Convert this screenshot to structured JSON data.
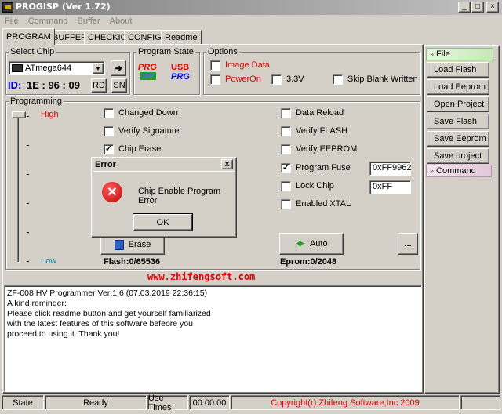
{
  "window": {
    "title": "PROGISP (Ver 1.72)"
  },
  "menu": [
    "File",
    "Command",
    "Buffer",
    "About"
  ],
  "tabs": [
    "PROGRAM",
    "BUFFER",
    "CHECKIO",
    "CONFIG",
    "Readme"
  ],
  "select_chip": {
    "group_label": "Select Chip",
    "chip": "ATmega644",
    "id_label": "ID:",
    "id_value": "1E : 96 : 09",
    "rd_label": "RD",
    "sn_label": "SN"
  },
  "program_state": {
    "group_label": "Program State",
    "logo1_top": "PRG",
    "logo1_bottom": "ISP",
    "logo2_top": "USB",
    "logo2_bottom": "PRG"
  },
  "options": {
    "group_label": "Options",
    "image_data": "Image Data",
    "power_on": "PowerOn",
    "v33": "3.3V",
    "skip_blank": "Skip Blank Written"
  },
  "programming": {
    "group_label": "Programming",
    "high": "High",
    "low": "Low",
    "changed_down": "Changed Down",
    "verify_signature": "Verify Signature",
    "chip_erase": "Chip Erase",
    "data_reload": "Data Reload",
    "verify_flash": "Verify FLASH",
    "verify_eeprom": "Verify EEPROM",
    "program_fuse": "Program Fuse",
    "fuse_value": "0xFF9962",
    "lock_chip": "Lock Chip",
    "lock_value": "0xFF",
    "enabled_xtal": "Enabled XTAL",
    "erase_label": "Erase",
    "auto_label": "Auto",
    "more_label": "...",
    "flash_count": "Flash:0/65536",
    "eprom_count": "Eprom:0/2048"
  },
  "dialog": {
    "title": "Error",
    "message": "Chip Enable Program Error",
    "ok_label": "OK",
    "close_label": "x"
  },
  "website": "www.zhifengsoft.com",
  "log": [
    "ZF-008 HV Programmer Ver:1.6 (07.03.2019 22:36:15)",
    "A kind reminder:",
    "Please click readme button and get yourself familiarized",
    "with the latest features of this software befeore you",
    "proceed to using it. Thank you!"
  ],
  "sidebar": {
    "file_header": "File",
    "buttons": [
      "Load Flash",
      "Load Eeprom",
      "Open Project",
      "Save Flash",
      "Save Eeprom",
      "Save project"
    ],
    "command_header": "Command"
  },
  "status": {
    "state_label": "State",
    "state_value": "Ready",
    "use_times_label": "Use Times",
    "time_value": "00:00:00",
    "copyright": "Copyright(r) Zhifeng Software,Inc 2009"
  },
  "colors": {
    "accent_red": "#e00000",
    "title_gray": "#808080",
    "face": "#d4d0c8"
  }
}
